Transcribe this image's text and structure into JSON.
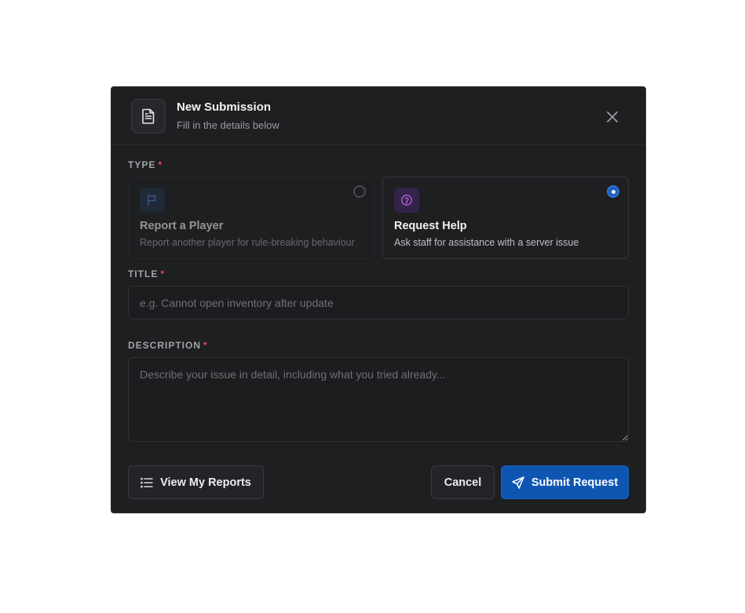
{
  "header": {
    "title": "New Submission",
    "subtitle": "Fill in the details below",
    "icon": "document-icon"
  },
  "type_field": {
    "label": "TYPE",
    "required_mark": "*",
    "options": [
      {
        "title": "Report a Player",
        "description": "Report another player for rule-breaking behaviour",
        "icon": "flag-icon",
        "accent": "#3b6fb0",
        "selected": false
      },
      {
        "title": "Request Help",
        "description": "Ask staff for assistance with a server issue",
        "icon": "help-circle-icon",
        "accent": "#a855c8",
        "selected": true
      }
    ]
  },
  "title_field": {
    "label": "TITLE",
    "required_mark": "*",
    "placeholder": "e.g. Cannot open inventory after update",
    "value": ""
  },
  "description_field": {
    "label": "DESCRIPTION",
    "required_mark": "*",
    "placeholder": "Describe your issue in detail, including what you tried already...",
    "value": ""
  },
  "footer": {
    "view_reports_label": "View My Reports",
    "cancel_label": "Cancel",
    "submit_label": "Submit Request"
  },
  "colors": {
    "primary": "#0f56b3",
    "required": "#e5484d",
    "surface": "#1e1f21"
  }
}
